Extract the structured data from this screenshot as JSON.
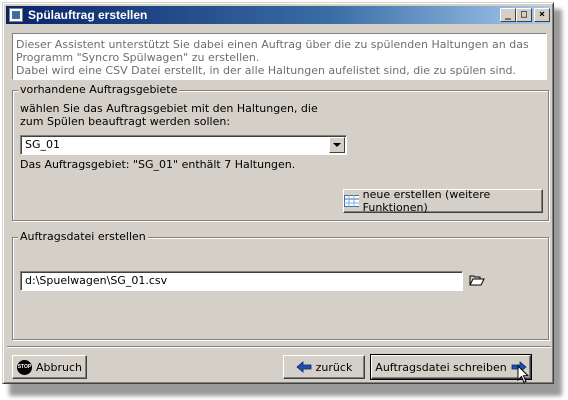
{
  "window": {
    "title": "Spülauftrag erstellen",
    "controls": {
      "minimize": "_",
      "maximize": "□",
      "close": "×"
    }
  },
  "description": {
    "line1": "Dieser Assistent unterstützt Sie dabei einen Auftrag über die zu spülenden Haltungen an das Programm \"Syncro Spülwagen\" zu erstellen.",
    "line2": "Dabei wird eine CSV Datei erstellt, in der alle Haltungen aufelistet sind, die zu spülen sind."
  },
  "area_group": {
    "title": "vorhandene Auftragsgebiete",
    "instruction_line1": "wählen Sie das Auftragsgebiet mit den Haltungen, die",
    "instruction_line2": "zum Spülen beauftragt werden sollen:",
    "selected_area": "SG_01",
    "info": "Das Auftragsgebiet: \"SG_01\" enthält 7 Haltungen.",
    "new_button_label": "neue erstellen (weitere Funktionen)"
  },
  "file_group": {
    "title": "Auftragsdatei erstellen",
    "file_path": "d:\\Spuelwagen\\SG_01.csv"
  },
  "footer": {
    "cancel_label": "Abbruch",
    "stop_icon_text": "STOP",
    "back_label": "zurück",
    "write_label": "Auftragsdatei schreiben"
  },
  "icons": {
    "title": "app-icon",
    "new": "table-icon",
    "browse": "folder-open-icon",
    "back": "arrow-left-icon",
    "write": "arrow-right-icon",
    "cancel": "stop-sign-icon",
    "cursor": "mouse-cursor-icon"
  },
  "colors": {
    "title_start": "#0a246a",
    "title_end": "#a6caf0",
    "window_bg": "#d4d0c8",
    "arrow_blue": "#1c4fb0"
  }
}
